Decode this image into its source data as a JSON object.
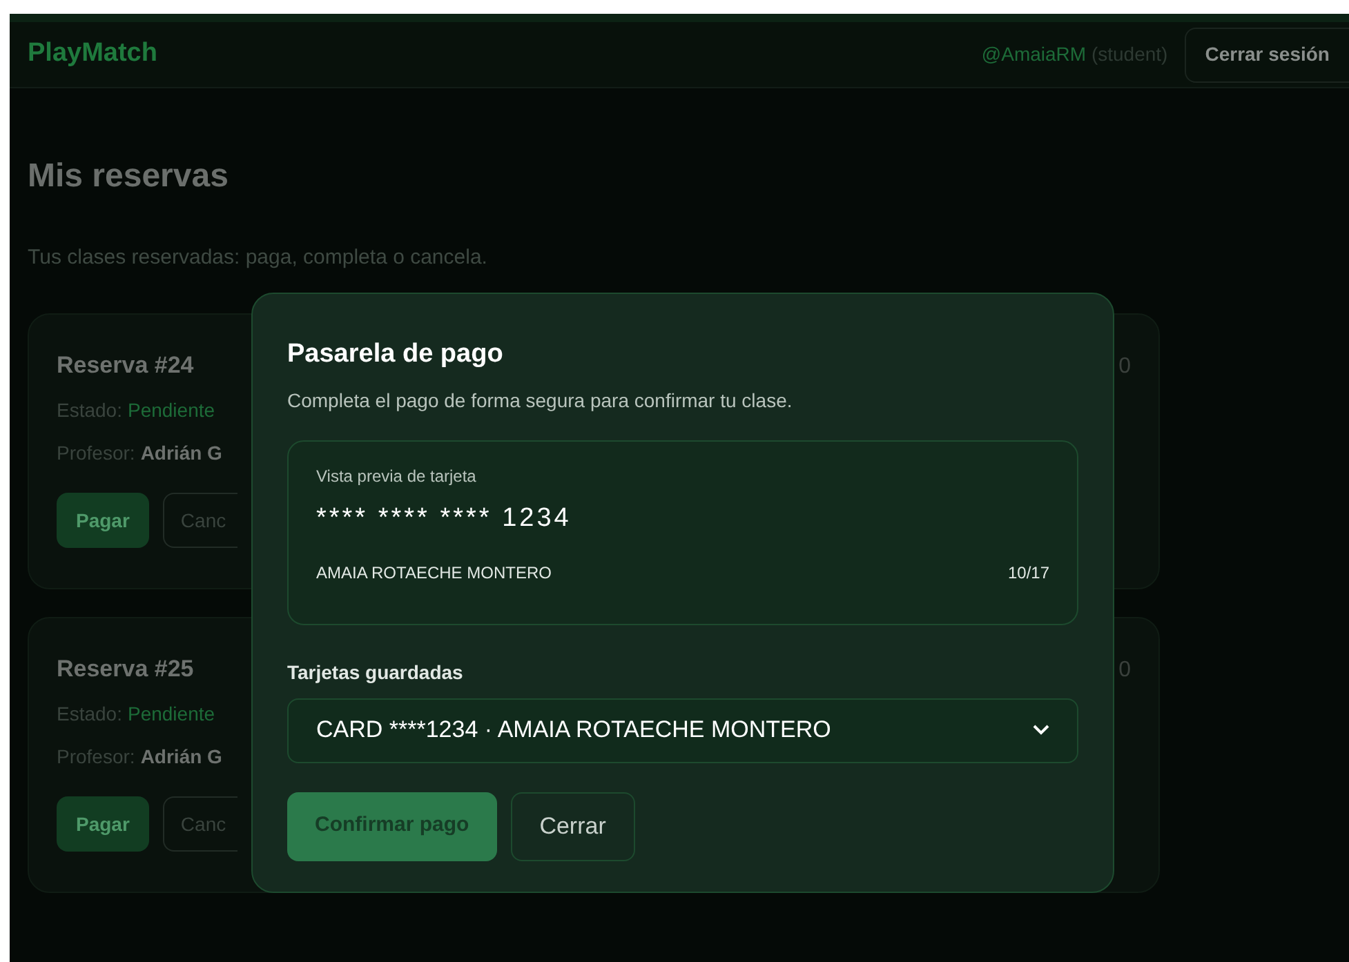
{
  "header": {
    "brand": "PlayMatch",
    "user": "@AmaiaRM",
    "role": "(student)",
    "logout": "Cerrar sesión"
  },
  "page": {
    "title": "Mis reservas",
    "subtitle": "Tus clases reservadas: paga, completa o cancela."
  },
  "reservations": [
    {
      "title": "Reserva #24",
      "status_label": "Estado:",
      "status": "Pendiente",
      "teacher_label": "Profesor:",
      "teacher": "Adrián G",
      "pay": "Pagar",
      "cancel": "Canc",
      "column_2": "0"
    },
    {
      "title": "Reserva #25",
      "status_label": "Estado:",
      "status": "Pendiente",
      "teacher_label": "Profesor:",
      "teacher": "Adrián G",
      "pay": "Pagar",
      "cancel": "Canc",
      "column_2": "0"
    }
  ],
  "modal": {
    "title": "Pasarela de pago",
    "subtitle": "Completa el pago de forma segura para confirmar tu clase.",
    "card_preview": {
      "label": "Vista previa de tarjeta",
      "number": "**** **** **** 1234",
      "holder": "AMAIA ROTAECHE MONTERO",
      "expiry": "10/17"
    },
    "saved_cards_label": "Tarjetas guardadas",
    "saved_card": "CARD ****1234 · AMAIA ROTAECHE MONTERO",
    "confirm": "Confirmar pago",
    "close": "Cerrar"
  }
}
